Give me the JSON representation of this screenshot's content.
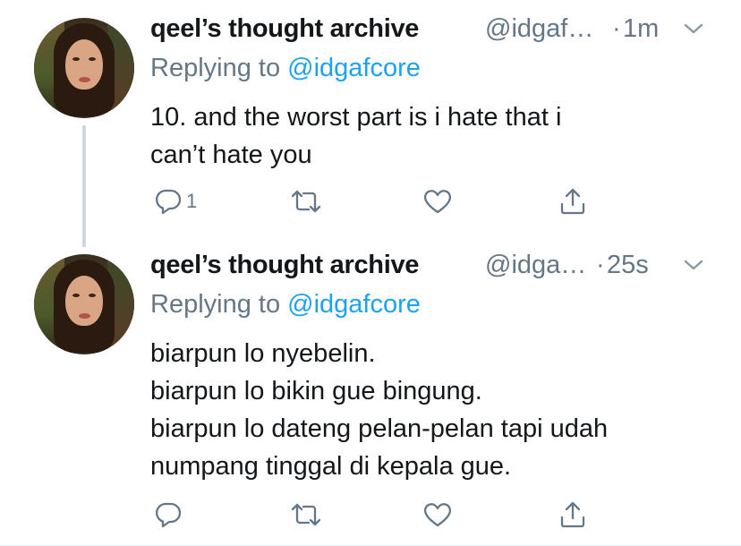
{
  "colors": {
    "text": "#14171a",
    "secondary": "#657786",
    "link": "#1da1f2",
    "thread_line": "#ccd6dd"
  },
  "tweets": [
    {
      "display_name": "qeel’s thought archive",
      "handle": "@idgaf…",
      "separator": "·",
      "time": "1m",
      "replying_prefix": "Replying to ",
      "replying_to": "@idgafcore",
      "lines": [
        "10. and the worst part is i hate that i",
        "can’t hate you"
      ],
      "reply_count": "1",
      "icons": [
        "reply-icon",
        "retweet-icon",
        "like-icon",
        "share-icon",
        "caret-down-icon"
      ]
    },
    {
      "display_name": "qeel’s thought archive",
      "handle": "@idga…",
      "separator": "·",
      "time": "25s",
      "replying_prefix": "Replying to ",
      "replying_to": "@idgafcore",
      "lines": [
        "biarpun lo nyebelin.",
        "biarpun lo bikin gue bingung.",
        "biarpun lo dateng pelan-pelan tapi udah",
        "numpang tinggal di kepala gue."
      ],
      "reply_count": "",
      "icons": [
        "reply-icon",
        "retweet-icon",
        "like-icon",
        "share-icon",
        "caret-down-icon"
      ]
    }
  ]
}
